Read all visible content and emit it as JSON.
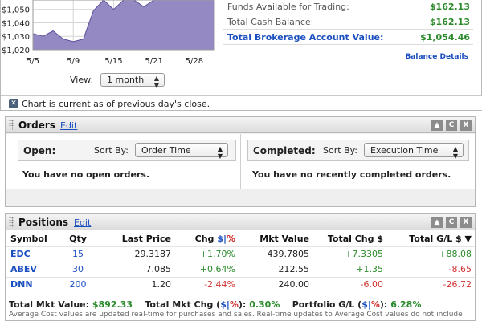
{
  "chart": {
    "view_label": "View:",
    "range_value": "1 month",
    "note": "Chart is current as of previous day's close.",
    "colors": {
      "fill": "#9489c2",
      "line": "#5c4f9a"
    }
  },
  "chart_data": {
    "type": "area",
    "title": "",
    "xlabel": "",
    "ylabel": "",
    "y_ticks": [
      "$1,050",
      "$1,040",
      "$1,030",
      "$1,020"
    ],
    "x_ticks": [
      "5/5",
      "5/9",
      "5/15",
      "5/21",
      "5/28"
    ],
    "ylim": [
      1020,
      1057
    ],
    "grid": true,
    "series": [
      {
        "x": [
          "5/5",
          "5/6",
          "5/7",
          "5/8",
          "5/9",
          "5/12",
          "5/13",
          "5/14",
          "5/15",
          "5/16",
          "5/19",
          "5/20",
          "5/21",
          "5/22",
          "5/23",
          "5/27",
          "5/28",
          "5/29",
          "5/30"
        ],
        "values": [
          1032,
          1030,
          1034,
          1028,
          1026,
          1028,
          1049,
          1057,
          1050,
          1057,
          1057,
          1052,
          1057,
          1057,
          1057,
          1057,
          1057,
          1057,
          1057
        ]
      }
    ]
  },
  "balances": {
    "rows": [
      {
        "label": "Funds Available for Trading:",
        "value": "$162.13"
      },
      {
        "label": "Total Cash Balance:",
        "value": "$162.13"
      },
      {
        "label": "Total Brokerage Account Value:",
        "value": "$1,054.46"
      }
    ],
    "details_link": "Balance Details"
  },
  "orders": {
    "title": "Orders",
    "edit": "Edit",
    "open": {
      "title": "Open:",
      "sort_label": "Sort By:",
      "sort_value": "Order Time",
      "empty": "You have no open orders."
    },
    "completed": {
      "title": "Completed:",
      "sort_label": "Sort By:",
      "sort_value": "Execution Time",
      "empty": "You have no recently completed orders."
    }
  },
  "positions": {
    "title": "Positions",
    "edit": "Edit",
    "headers": {
      "symbol": "Symbol",
      "qty": "Qty",
      "last_price": "Last Price",
      "chg": "Chg",
      "dollar": "$",
      "sep": "|",
      "pct": "%",
      "mkt_value": "Mkt Value",
      "total_chg": "Total Chg $",
      "total_gl": "Total G/L $",
      "sort_arrow": "▼"
    },
    "rows": [
      {
        "symbol": "EDC",
        "qty": "15",
        "last_price": "29.3187",
        "chg": "+1.70%",
        "mkt_value": "439.7805",
        "total_chg": "+7.3305",
        "total_gl": "+88.08"
      },
      {
        "symbol": "ABEV",
        "qty": "30",
        "last_price": "7.085",
        "chg": "+0.64%",
        "mkt_value": "212.55",
        "total_chg": "+1.35",
        "total_gl": "-8.65"
      },
      {
        "symbol": "DNN",
        "qty": "200",
        "last_price": "1.20",
        "chg": "-2.44%",
        "mkt_value": "240.00",
        "total_chg": "-6.00",
        "total_gl": "-26.72"
      }
    ],
    "summary": {
      "mkt_label": "Total Mkt Value:",
      "mkt_value": "$892.33",
      "chg_label": "Total Mkt Chg (",
      "chg_dollar": "$",
      "chg_sep": "|",
      "chg_pct": "%",
      "chg_close": "):",
      "chg_value": "0.30%",
      "gl_label": "Portfolio G/L (",
      "gl_dollar": "$",
      "gl_sep": "|",
      "gl_pct": "%",
      "gl_close": "):",
      "gl_value": "6.28%"
    },
    "footnote": "Average Cost values are updated real-time for purchases and sales. Real-time updates to Average Cost values do not include"
  },
  "icons": {
    "info": "info-icon",
    "grip": "grip-icon",
    "collapse": "collapse-icon",
    "refresh": "refresh-icon",
    "close": "close-icon"
  }
}
